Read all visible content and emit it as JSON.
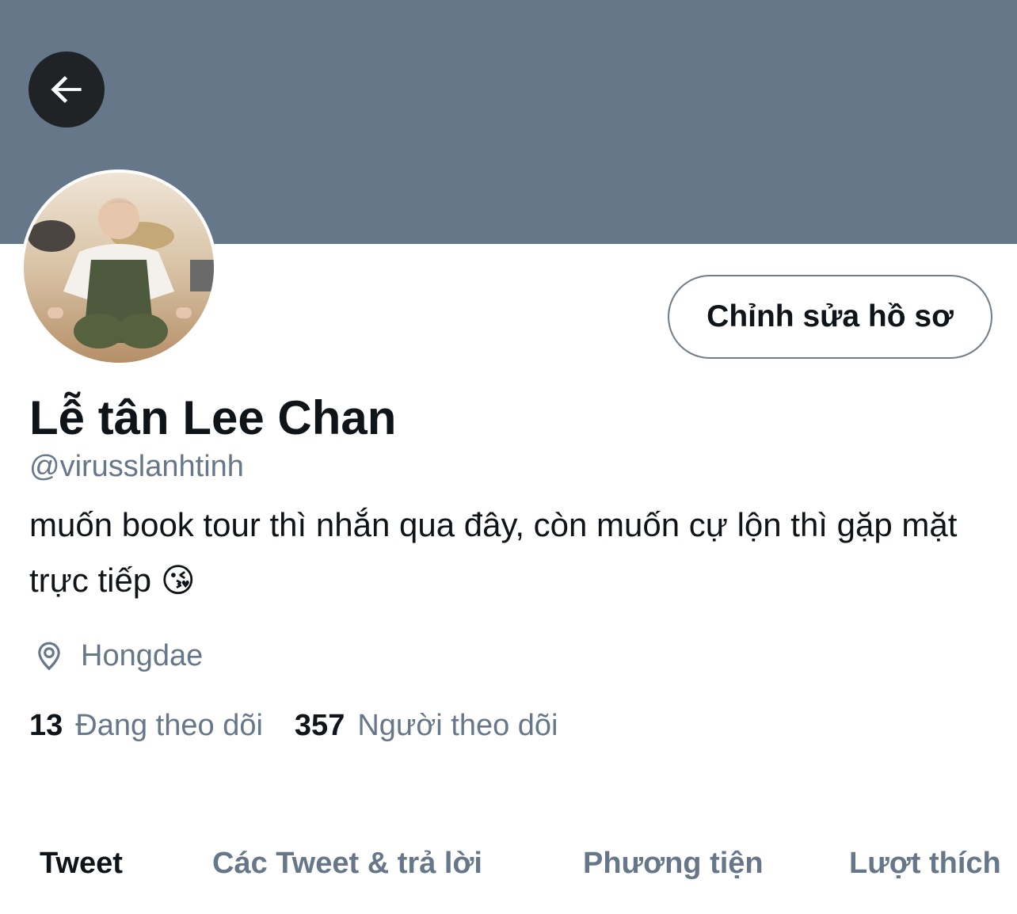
{
  "header": {
    "back_icon": "arrow-left-icon"
  },
  "colors": {
    "banner": "#66778a",
    "text_primary": "#0f1419",
    "text_secondary": "#66778a"
  },
  "profile": {
    "avatar_alt": "avatar",
    "edit_button_label": "Chỉnh sửa hồ sơ",
    "display_name": "Lễ tân Lee Chan",
    "handle": "@virusslanhtinh",
    "bio": "muốn book tour thì nhắn qua đây, còn muốn cự lộn thì gặp mặt trực tiếp 😘",
    "location_icon": "location-pin-icon",
    "location": "Hongdae",
    "following_count": "13",
    "following_label": "Đang theo dõi",
    "followers_count": "357",
    "followers_label": "Người theo dõi"
  },
  "tabs": [
    {
      "label": "Tweet",
      "active": true
    },
    {
      "label": "Các Tweet & trả lời",
      "active": false
    },
    {
      "label": "Phương tiện",
      "active": false
    },
    {
      "label": "Lượt thích",
      "active": false
    }
  ]
}
